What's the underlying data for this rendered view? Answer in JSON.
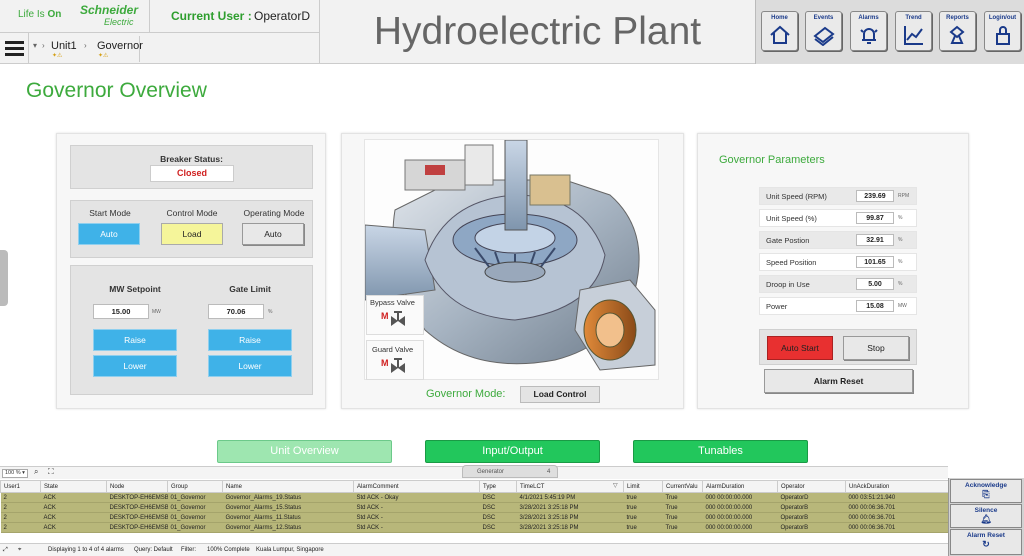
{
  "header": {
    "logo": {
      "life": "Life Is",
      "on": "On",
      "brand": "Schneider",
      "brand2": "Electric"
    },
    "user_label": "Current User :",
    "user_value": "OperatorD",
    "title": "Hydroelectric Plant",
    "breadcrumb": [
      "Unit1",
      "Governor"
    ],
    "nav_buttons": [
      {
        "label": "Home",
        "icon": "home-icon"
      },
      {
        "label": "Events",
        "icon": "events-icon"
      },
      {
        "label": "Alarms",
        "icon": "alarm-bell-icon"
      },
      {
        "label": "Trend",
        "icon": "trend-chart-icon"
      },
      {
        "label": "Reports",
        "icon": "reports-icon"
      },
      {
        "label": "Login/out",
        "icon": "lock-icon"
      }
    ]
  },
  "page_title": "Governor Overview",
  "left": {
    "breaker_label": "Breaker Status:",
    "breaker_value": "Closed",
    "modes": [
      {
        "label": "Start Mode",
        "value": "Auto"
      },
      {
        "label": "Control Mode",
        "value": "Load"
      },
      {
        "label": "Operating Mode",
        "value": "Auto"
      }
    ],
    "setpoints": [
      {
        "label": "MW Setpoint",
        "value": "15.00",
        "unit": "MW",
        "raise": "Raise",
        "lower": "Lower"
      },
      {
        "label": "Gate Limit",
        "value": "70.06",
        "unit": "%",
        "raise": "Raise",
        "lower": "Lower"
      }
    ]
  },
  "mid": {
    "bypass_label": "Bypass Valve",
    "guard_label": "Guard Valve",
    "valve_m": "M",
    "mode_label": "Governor Mode:",
    "mode_value": "Load Control"
  },
  "params": {
    "title": "Governor Parameters",
    "rows": [
      {
        "label": "Unit Speed (RPM)",
        "value": "239.69",
        "unit": "RPM"
      },
      {
        "label": "Unit Speed (%)",
        "value": "99.87",
        "unit": "%"
      },
      {
        "label": "Gate Postion",
        "value": "32.91",
        "unit": "%"
      },
      {
        "label": "Speed Position",
        "value": "101.65",
        "unit": "%"
      },
      {
        "label": "Droop in Use",
        "value": "5.00",
        "unit": "%"
      },
      {
        "label": "Power",
        "value": "15.08",
        "unit": "MW"
      }
    ],
    "auto_start": "Auto Start",
    "stop": "Stop",
    "alarm_reset": "Alarm Reset"
  },
  "nav": [
    "Unit Overview",
    "Input/Output",
    "Tunables"
  ],
  "alarms": {
    "zoom": "100 %",
    "tab": "Generator",
    "tab_count": "4",
    "columns": [
      "User1",
      "State",
      "Node",
      "Group",
      "Name",
      "AlarmComment",
      "Type",
      "TimeLCT",
      "Limit",
      "CurrentValu",
      "AlarmDuration",
      "Operator",
      "UnAckDuration"
    ],
    "rows": [
      [
        "2",
        "ACK",
        "DESKTOP-EH6EMSB",
        "01_Governor",
        "Governor_Alarms_19.Status",
        "Std ACK - Okay",
        "DSC",
        "4/1/2021 5:45:19 PM",
        "true",
        "True",
        "000 00:00:00.000",
        "OperatorD",
        "000 03:51:21.940"
      ],
      [
        "2",
        "ACK",
        "DESKTOP-EH6EMSB",
        "01_Governor",
        "Governor_Alarms_15.Status",
        "Std ACK -",
        "DSC",
        "3/28/2021 3:25:18 PM",
        "true",
        "True",
        "000 00:00:00.000",
        "OperatorB",
        "000 00:06:36.701"
      ],
      [
        "2",
        "ACK",
        "DESKTOP-EH6EMSB",
        "01_Governor",
        "Governor_Alarms_11.Status",
        "Std ACK -",
        "DSC",
        "3/28/2021 3:25:18 PM",
        "true",
        "True",
        "000 00:00:00.000",
        "OperatorB",
        "000 00:06:36.701"
      ],
      [
        "2",
        "ACK",
        "DESKTOP-EH6EMSB",
        "01_Governor",
        "Governor_Alarms_12.Status",
        "Std ACK -",
        "DSC",
        "3/28/2021 3:25:18 PM",
        "true",
        "True",
        "000 00:00:00.000",
        "OperatorB",
        "000 00:06:36.701"
      ]
    ],
    "status": [
      "Displaying 1 to 4 of 4 alarms",
      "Query: Default",
      "Filter:",
      "100% Complete",
      "Kuala Lumpur, Singapore"
    ],
    "side_buttons": [
      "Acknowledge",
      "Silence",
      "Alarm Reset"
    ]
  },
  "colors": {
    "accent_green": "#3daa3d",
    "nav_green": "#22c75c",
    "blue_button": "#3fb2e8",
    "alarm_row": "#b8b77a",
    "auto_start_red": "#e83030"
  }
}
